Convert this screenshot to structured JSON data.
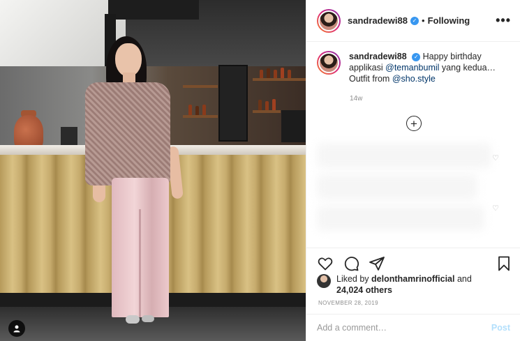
{
  "post": {
    "author": "sandradewi88",
    "verified_icon": "verified-badge-icon",
    "separator": "•",
    "follow_state": "Following",
    "more_label": "•••",
    "caption": {
      "author": "sandradewi88",
      "text_1": "Happy birthday applikasi ",
      "mention_1": "@temanbumil",
      "text_2": " yang kedua…",
      "text_3": "Outfit from ",
      "mention_2": "@sho.style"
    },
    "caption_age": "14w",
    "load_more_label": "+",
    "liked_by_prefix": "Liked by ",
    "liked_by_user": "delonthamrinofficial",
    "liked_by_and": " and",
    "others_count": "24,024 others",
    "date": "NOVEMBER 28, 2019",
    "comment_placeholder": "Add a comment…",
    "post_button": "Post"
  },
  "icons": {
    "like": "heart-icon",
    "comment": "comment-icon",
    "share": "share-icon",
    "save": "bookmark-icon",
    "tag": "user-tag-icon"
  },
  "colors": {
    "accent": "#3897f0",
    "mention": "#003569",
    "post_button_disabled": "#b2dffc"
  }
}
